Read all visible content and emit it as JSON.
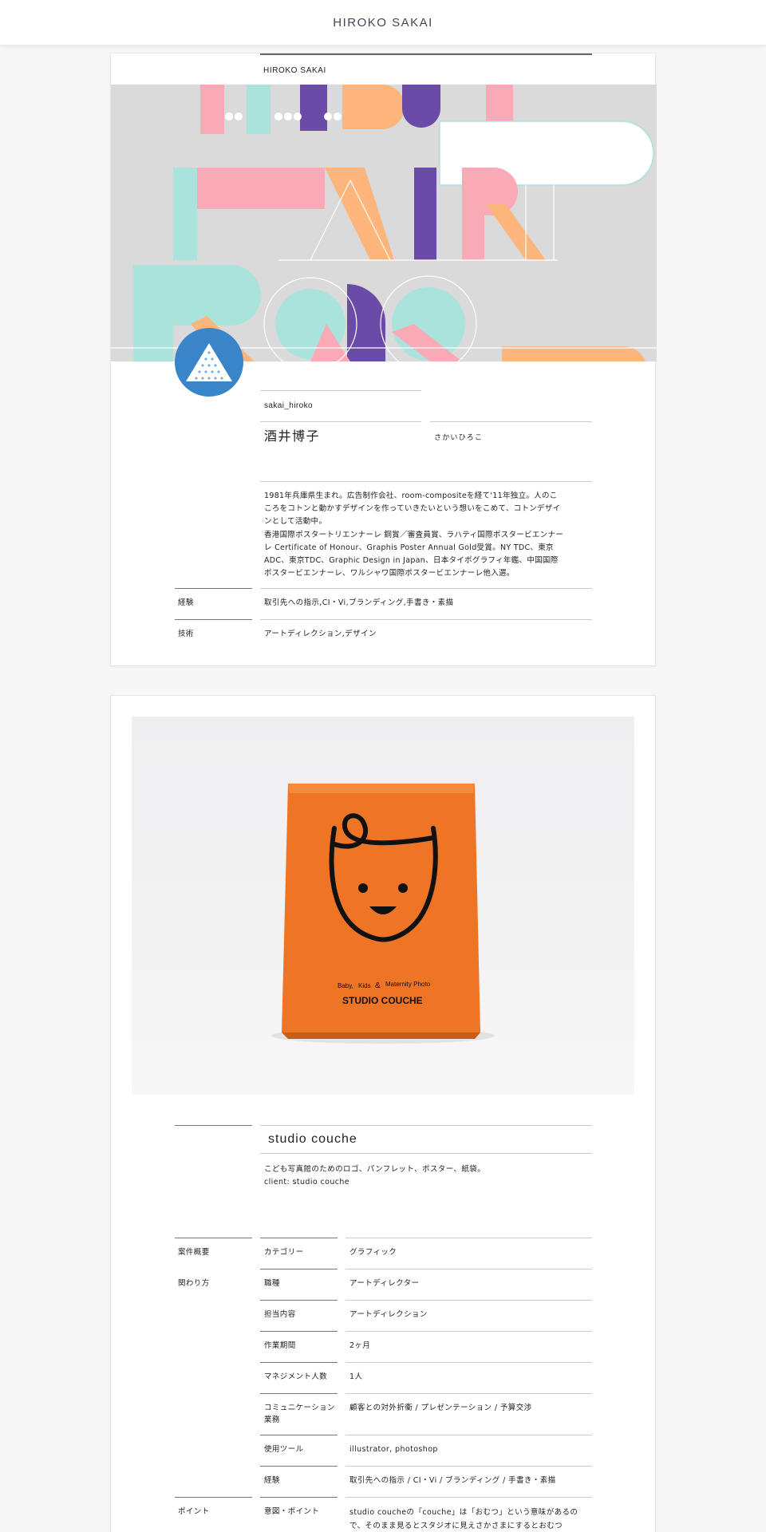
{
  "header": {
    "site_title": "HIROKO SAKAI"
  },
  "profile": {
    "name_heading": "HIROKO SAKAI",
    "handle": "sakai_hiroko",
    "full_name": "酒井博子",
    "kana": "さかいひろこ",
    "bio_lines": [
      " 1981年兵庫県生まれ。広告制作会社、room-compositeを経て'11年独立。人のこ",
      "ころをコトンと動かすデザインを作っていきたいという想いをこめて、コトンデザイ",
      "ンとして活動中。",
      "香港国際ポスタートリエンナーレ 銅賞／審査員賞、ラハティ国際ポスタービエンナー",
      "レ Certificate of Honour、Graphis Poster Annual Gold受賞。NY TDC、東京",
      "ADC、東京TDC、Graphic Design in Japan、日本タイポグラフィ年鑑、中国国際",
      "ポスタービエンナーレ、ワルシャワ国際ポスタービエンナーレ他入選。"
    ],
    "experience_label": "経験",
    "experience_value": "取引先への指示,CI・Vi,ブランディング,手書き・素描",
    "skills_label": "技術",
    "skills_value": "アートディレクション,デザイン",
    "cover_colors": {
      "mint": "#a9e3dc",
      "pink": "#f9aab6",
      "purple": "#6a4ca8",
      "orange": "#fcb57a"
    },
    "avatar_color": "#3a84c9"
  },
  "work": {
    "photo_bag": {
      "color": "#ee7426",
      "line_small_1": "Baby,",
      "line_small_2": "Kids",
      "line_amp": "&",
      "line_small_3": "Maternity Photo",
      "line_big": "STUDIO COUCHE"
    },
    "title": "studio couche",
    "description_lines": [
      " こども写真館のためのロゴ、パンフレット、ポスター、紙袋。",
      "client: studio couche"
    ],
    "spec_section_overview": "案件概要",
    "spec_section_role": "関わり方",
    "spec_section_point": "ポイント",
    "specs": [
      {
        "label": "カテゴリー",
        "value": "グラフィック"
      },
      {
        "label": "職種",
        "value": "アートディレクター"
      },
      {
        "label": "担当内容",
        "value": "アートディレクション"
      },
      {
        "label": "作業期間",
        "value": "2ヶ月"
      },
      {
        "label": "マネジメント人数",
        "value": "1人"
      },
      {
        "label": "コミュニケーション業務",
        "value": "顧客との対外折衝 / プレゼンテーション / 予算交渉"
      },
      {
        "label": "使用ツール",
        "value": " illustrator, photoshop"
      },
      {
        "label": "経験",
        "value": "取引先への指示 / CI・Vi / ブランディング / 手書き・素描"
      },
      {
        "label": "意図・ポイント",
        "value": " studio coucheの「couche」は「おむつ」という意味があるので、そのまま見るとスタジオに見えさかさまにするとおむつ"
      }
    ]
  }
}
